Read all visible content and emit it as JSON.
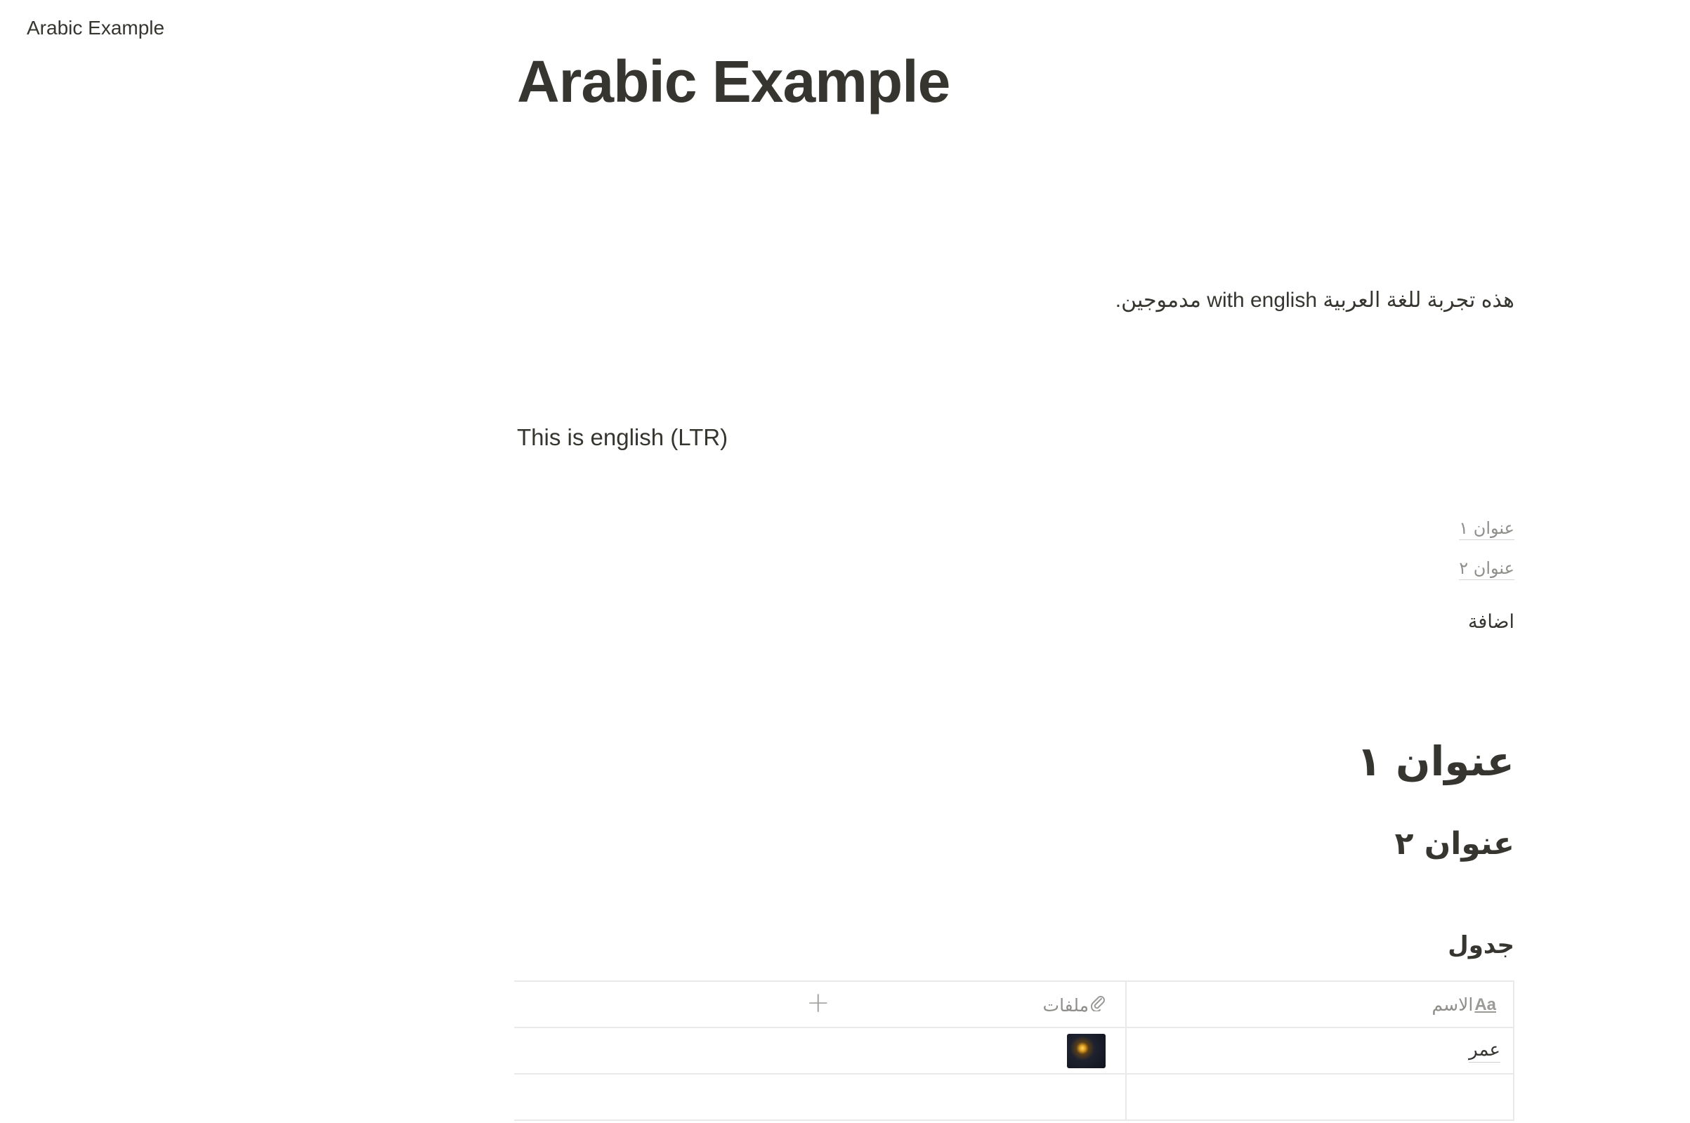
{
  "breadcrumb": {
    "page": "Arabic Example"
  },
  "page": {
    "title": "Arabic Example",
    "rtl_paragraph": "هذه تجربة للغة العربية with english مدموجين.",
    "ltr_paragraph": "This is english (LTR)",
    "toc": [
      "عنوان ١",
      "عنوان ٢"
    ],
    "add_label": "اضافة",
    "heading1": "عنوان ١",
    "heading2": "عنوان ٢",
    "heading3": "جدول"
  },
  "table": {
    "columns": [
      {
        "label": "الاسم",
        "icon": "Aa"
      },
      {
        "label": "ملفات",
        "icon": "paperclip-icon"
      }
    ],
    "add_column_icon": "+",
    "rows": [
      {
        "name": "عمر",
        "file": "night-lamp-thumbnail"
      },
      {
        "name": "",
        "file": ""
      }
    ]
  }
}
